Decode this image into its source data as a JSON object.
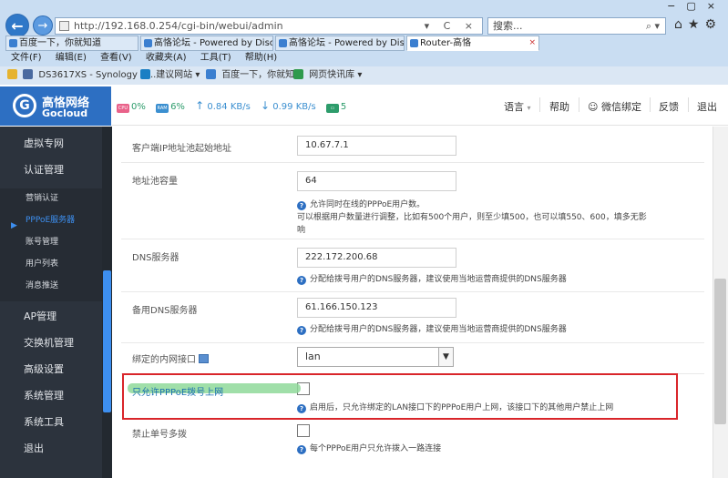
{
  "browser": {
    "url": "http://192.168.0.254/cgi-bin/webui/admin",
    "search_placeholder": "搜索...",
    "tabs": [
      {
        "label": "百度一下，你就知道"
      },
      {
        "label": "高恪论坛 - Powered by Disc..."
      },
      {
        "label": "高恪论坛 - Powered by Disc..."
      },
      {
        "label": "Router-高恪"
      }
    ],
    "menu": [
      "文件(F)",
      "编辑(E)",
      "查看(V)",
      "收藏夹(A)",
      "工具(T)",
      "帮助(H)"
    ],
    "favorites": [
      {
        "label": "DS3617XS - Synology D..."
      },
      {
        "label": "建议网站 ▾"
      },
      {
        "label": "百度一下，你就知道"
      },
      {
        "label": "网页快讯库 ▾"
      }
    ]
  },
  "header": {
    "logo_cn": "高恪网络",
    "logo_en": "Gocloud",
    "cpu_label": "CPU",
    "cpu": "0%",
    "ram_label": "RAM",
    "ram": "6%",
    "up": "0.84 KB/s",
    "down": "0.99 KB/s",
    "conn": "5",
    "lang": "语言",
    "help": "帮助",
    "wechat": "微信绑定",
    "feedback": "反馈",
    "logout": "退出"
  },
  "sidebar": {
    "items": [
      {
        "label": "虚拟专网"
      },
      {
        "label": "认证管理"
      },
      {
        "label": "AP管理"
      },
      {
        "label": "交换机管理"
      },
      {
        "label": "高级设置"
      },
      {
        "label": "系统管理"
      },
      {
        "label": "系统工具"
      },
      {
        "label": "退出"
      }
    ],
    "subitems": [
      {
        "label": "营销认证"
      },
      {
        "label": "PPPoE服务器"
      },
      {
        "label": "账号管理"
      },
      {
        "label": "用户列表"
      },
      {
        "label": "消息推送"
      }
    ]
  },
  "form": {
    "client_ip_start_label": "客户端IP地址池起始地址",
    "client_ip_start": "10.67.7.1",
    "pool_size_label": "地址池容量",
    "pool_size": "64",
    "pool_size_hint1": "允许同时在线的PPPoE用户数。",
    "pool_size_hint2": "可以根据用户数量进行调整，比如有500个用户，则至少填500，也可以填550、600，填多无影",
    "pool_size_hint3": "响",
    "dns_label": "DNS服务器",
    "dns": "222.172.200.68",
    "dns_hint": "分配给拨号用户的DNS服务器，建议使用当地运营商提供的DNS服务器",
    "dns2_label": "备用DNS服务器",
    "dns2": "61.166.150.123",
    "dns2_hint": "分配给拨号用户的DNS服务器，建议使用当地运营商提供的DNS服务器",
    "lan_label": "绑定的内网接口",
    "lan_value": "lan",
    "only_pppoe_label": "只允许PPPoE拨号上网",
    "only_pppoe_hint": "启用后，只允许绑定的LAN接口下的PPPoE用户上网，该接口下的其他用户禁止上网",
    "no_multi_label": "禁止单号多拨",
    "no_multi_hint": "每个PPPoE用户只允许拨入一路连接"
  }
}
